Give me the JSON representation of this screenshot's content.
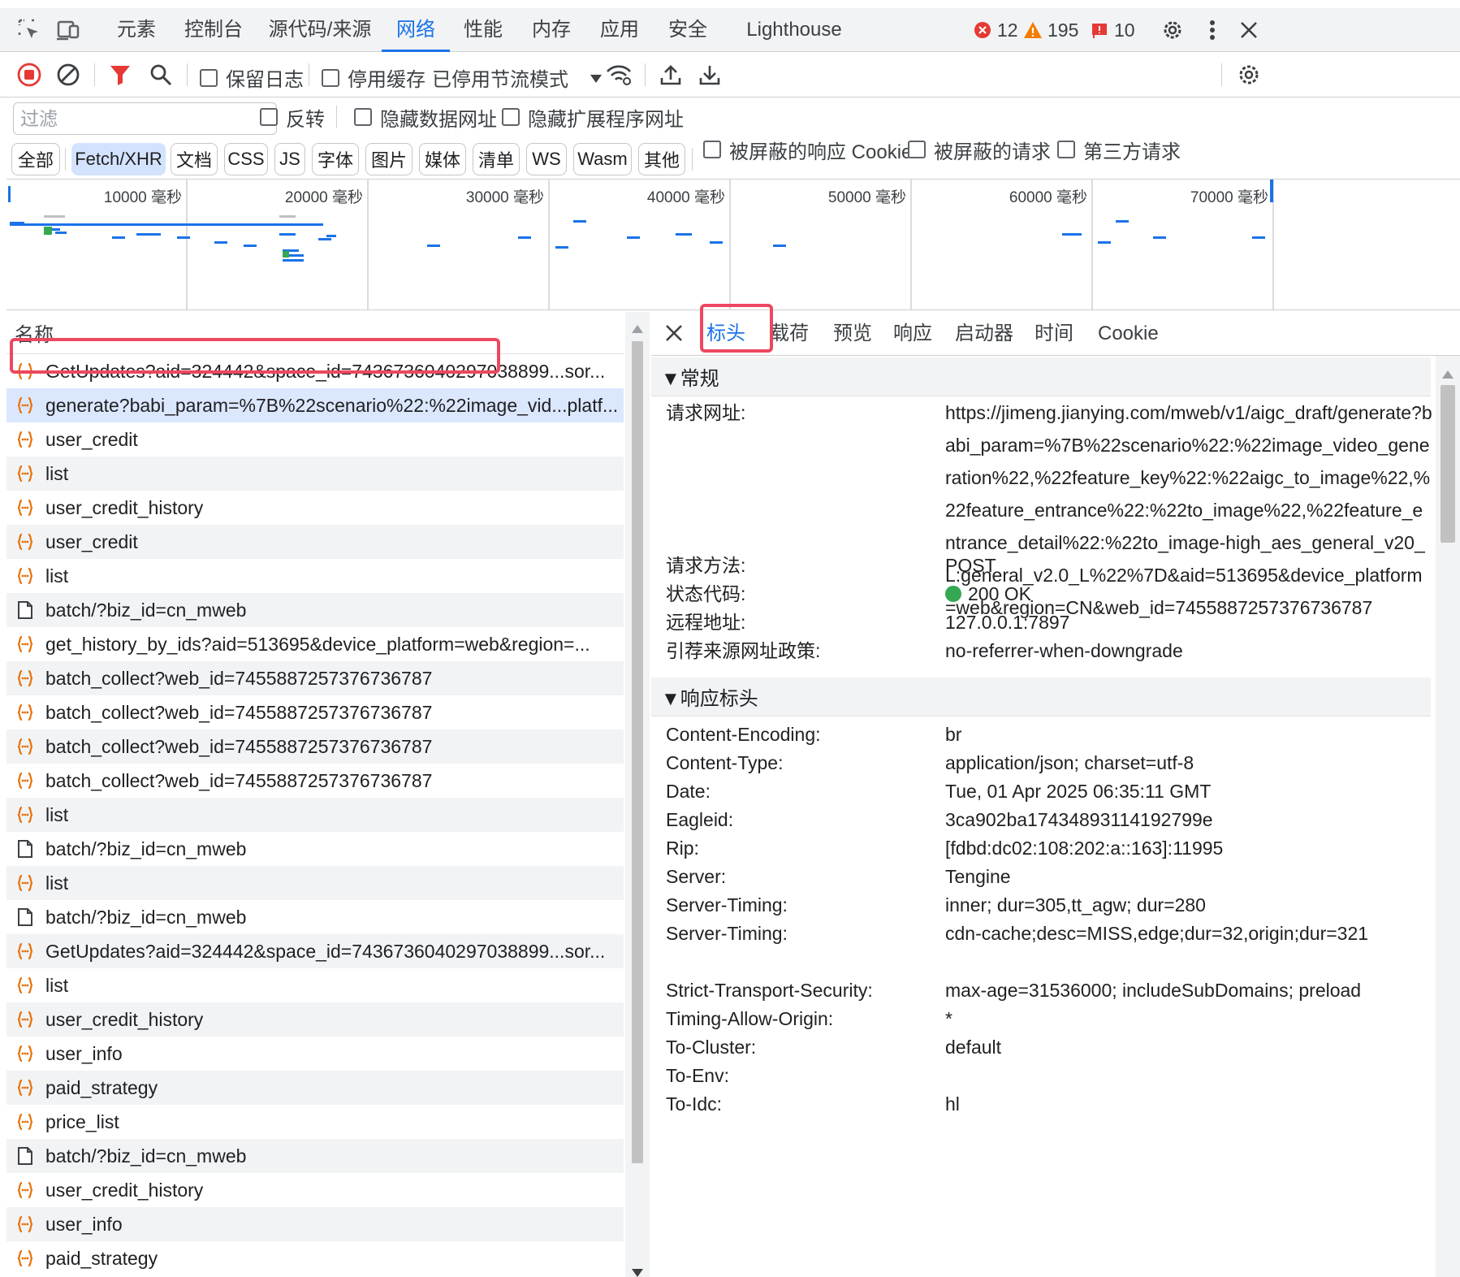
{
  "main_tabs": [
    "元素",
    "控制台",
    "源代码/来源",
    "网络",
    "性能",
    "内存",
    "应用",
    "安全",
    "Lighthouse"
  ],
  "issues": {
    "errors": "12",
    "warnings": "195",
    "infos": "10"
  },
  "toolbar": {
    "preserve_log": "保留日志",
    "disable_cache": "停用缓存",
    "throttle": "已停用节流模式"
  },
  "filter": {
    "placeholder": "过滤",
    "invert": "反转",
    "hide_data_urls": "隐藏数据网址",
    "hide_ext_urls": "隐藏扩展程序网址",
    "types": [
      "全部",
      "Fetch/XHR",
      "文档",
      "CSS",
      "JS",
      "字体",
      "图片",
      "媒体",
      "清单",
      "WS",
      "Wasm",
      "其他"
    ],
    "blocked_cookies": "被屏蔽的响应 Cookie",
    "blocked_requests": "被屏蔽的请求",
    "third_party": "第三方请求"
  },
  "overview_ticks": [
    "10000 毫秒",
    "20000 毫秒",
    "30000 毫秒",
    "40000 毫秒",
    "50000 毫秒",
    "60000 毫秒",
    "70000 毫秒"
  ],
  "list": {
    "header": "名称",
    "rows": [
      {
        "name": "GetUpdates?aid=324442&space_id=7436736040297038899...sor...",
        "icon": "xhr-icon"
      },
      {
        "name": "generate?babi_param=%7B%22scenario%22:%22image_vid...platf...",
        "icon": "xhr-icon"
      },
      {
        "name": "user_credit",
        "icon": "xhr-icon"
      },
      {
        "name": "list",
        "icon": "xhr-icon"
      },
      {
        "name": "user_credit_history",
        "icon": "xhr-icon"
      },
      {
        "name": "user_credit",
        "icon": "xhr-icon"
      },
      {
        "name": "list",
        "icon": "xhr-icon"
      },
      {
        "name": "batch/?biz_id=cn_mweb",
        "icon": "document-icon"
      },
      {
        "name": "get_history_by_ids?aid=513695&device_platform=web&region=...",
        "icon": "xhr-icon"
      },
      {
        "name": "batch_collect?web_id=7455887257376736787",
        "icon": "xhr-icon"
      },
      {
        "name": "batch_collect?web_id=7455887257376736787",
        "icon": "xhr-icon"
      },
      {
        "name": "batch_collect?web_id=7455887257376736787",
        "icon": "xhr-icon"
      },
      {
        "name": "batch_collect?web_id=7455887257376736787",
        "icon": "xhr-icon"
      },
      {
        "name": "list",
        "icon": "xhr-icon"
      },
      {
        "name": "batch/?biz_id=cn_mweb",
        "icon": "document-icon"
      },
      {
        "name": "list",
        "icon": "xhr-icon"
      },
      {
        "name": "batch/?biz_id=cn_mweb",
        "icon": "document-icon"
      },
      {
        "name": "GetUpdates?aid=324442&space_id=7436736040297038899...sor...",
        "icon": "xhr-icon"
      },
      {
        "name": "list",
        "icon": "xhr-icon"
      },
      {
        "name": "user_credit_history",
        "icon": "xhr-icon"
      },
      {
        "name": "user_info",
        "icon": "xhr-icon"
      },
      {
        "name": "paid_strategy",
        "icon": "xhr-icon"
      },
      {
        "name": "price_list",
        "icon": "xhr-icon"
      },
      {
        "name": "batch/?biz_id=cn_mweb",
        "icon": "document-icon"
      },
      {
        "name": "user_credit_history",
        "icon": "xhr-icon"
      },
      {
        "name": "user_info",
        "icon": "xhr-icon"
      },
      {
        "name": "paid_strategy",
        "icon": "xhr-icon"
      }
    ]
  },
  "detail_tabs": [
    "标头",
    "载荷",
    "预览",
    "响应",
    "启动器",
    "时间",
    "Cookie"
  ],
  "general": {
    "title": "▼常规",
    "url_label": "请求网址:",
    "url_value": "https://jimeng.jianying.com/mweb/v1/aigc_draft/generate?babi_param=%7B%22scenario%22:%22image_video_generation%22,%22feature_key%22:%22aigc_to_image%22,%22feature_entrance%22:%22to_image%22,%22feature_entrance_detail%22:%22to_image-high_aes_general_v20_L:general_v2.0_L%22%7D&aid=513695&device_platform=web&region=CN&web_id=7455887257376736787",
    "method_label": "请求方法:",
    "method_value": "POST",
    "status_label": "状态代码:",
    "status_value": "200 OK",
    "status_color": "#34a853",
    "remote_label": "远程地址:",
    "remote_value": "127.0.0.1:7897",
    "referrer_label": "引荐来源网址政策:",
    "referrer_value": "no-referrer-when-downgrade"
  },
  "response_headers": {
    "title": "▼响应标头",
    "items": [
      {
        "k": "Content-Encoding:",
        "v": "br"
      },
      {
        "k": "Content-Type:",
        "v": "application/json; charset=utf-8"
      },
      {
        "k": "Date:",
        "v": "Tue, 01 Apr 2025 06:35:11 GMT"
      },
      {
        "k": "Eagleid:",
        "v": "3ca902ba17434893114192799e"
      },
      {
        "k": "Rip:",
        "v": "[fdbd:dc02:108:202:a::163]:11995"
      },
      {
        "k": "Server:",
        "v": "Tengine"
      },
      {
        "k": "Server-Timing:",
        "v": "inner; dur=305,tt_agw; dur=280"
      },
      {
        "k": "Server-Timing:",
        "v": "cdn-cache;desc=MISS,edge;dur=32,origin;dur=321"
      },
      {
        "k": "Strict-Transport-Security:",
        "v": "max-age=31536000; includeSubDomains; preload"
      },
      {
        "k": "Timing-Allow-Origin:",
        "v": "*"
      },
      {
        "k": "To-Cluster:",
        "v": "default"
      },
      {
        "k": "To-Env:",
        "v": ""
      },
      {
        "k": "To-Idc:",
        "v": "hl"
      }
    ]
  },
  "colors": {
    "accent": "#1a73e8",
    "highlight": "#ec4860",
    "error": "#e53935",
    "warning": "#f57c00"
  }
}
